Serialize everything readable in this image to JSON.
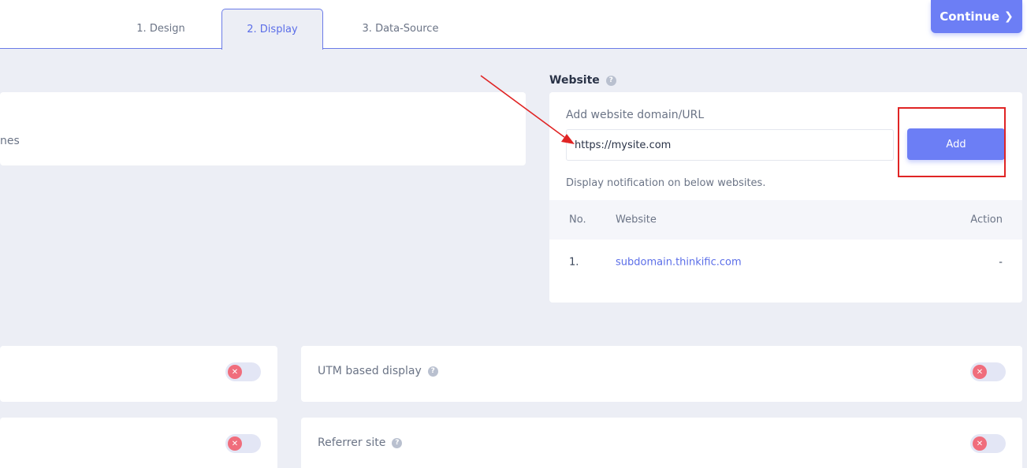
{
  "tabs": [
    {
      "label": "1. Design"
    },
    {
      "label": "2. Display"
    },
    {
      "label": "3. Data-Source"
    }
  ],
  "continue": {
    "label": "Continue",
    "icon": "chevron-right-icon"
  },
  "left_card": {
    "partial_text": "nes"
  },
  "website": {
    "title": "Website",
    "help_icon": "question-icon",
    "url_label": "Add website domain/URL",
    "url_value": "https://mysite.com",
    "add_label": "Add",
    "display_note": "Display notification on below websites.",
    "table": {
      "headers": {
        "no": "No.",
        "website": "Website",
        "action": "Action"
      },
      "rows": [
        {
          "no": "1.",
          "website": "subdomain.thinkific.com",
          "action": "-"
        }
      ]
    }
  },
  "toggles": {
    "utm": {
      "label": "UTM based display",
      "enabled": false
    },
    "referrer": {
      "label": "Referrer site",
      "enabled": false
    }
  },
  "colors": {
    "accent": "#6c7ef5",
    "annotation": "#e02424",
    "toggle_off": "#f06d7c"
  }
}
